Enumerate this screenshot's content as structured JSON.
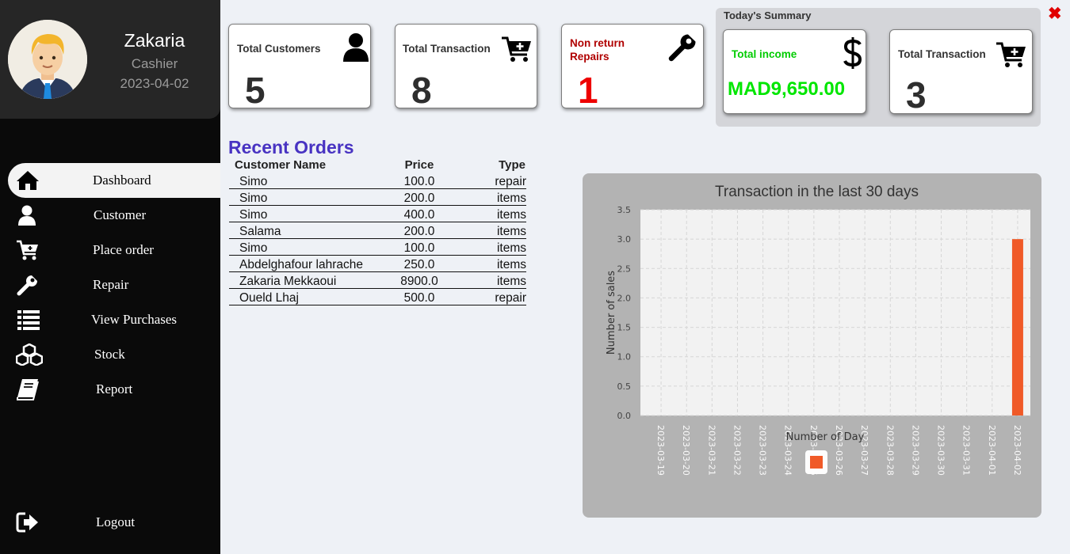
{
  "profile": {
    "name": "Zakaria",
    "role": "Cashier",
    "date": "2023-04-02"
  },
  "nav": [
    {
      "id": "dashboard",
      "label": "Dashboard",
      "icon": "home-icon",
      "active": true
    },
    {
      "id": "customer",
      "label": "Customer",
      "icon": "user-icon"
    },
    {
      "id": "place-order",
      "label": "Place order",
      "icon": "cart-plus-icon"
    },
    {
      "id": "repair",
      "label": "Repair",
      "icon": "wrench-icon"
    },
    {
      "id": "view-purchases",
      "label": "View Purchases",
      "icon": "list-icon"
    },
    {
      "id": "stock",
      "label": "Stock",
      "icon": "boxes-icon"
    },
    {
      "id": "report",
      "label": "Report",
      "icon": "book-icon"
    }
  ],
  "logout": {
    "label": "Logout",
    "icon": "logout-icon"
  },
  "cards": {
    "total_customers": {
      "title": "Total Customers",
      "value": "5",
      "icon": "user-icon"
    },
    "total_transaction": {
      "title": "Total Transaction",
      "value": "8",
      "icon": "cart-plus-icon"
    },
    "non_return_repairs": {
      "title": "Non return Repairs",
      "value": "1",
      "icon": "wrench-icon",
      "color": "#ee0000",
      "title_color": "#b00000"
    }
  },
  "summary": {
    "title": "Today's Summary",
    "income": {
      "title": "Total income",
      "value": "MAD9,650.00",
      "icon": "dollar-icon",
      "color": "#00e600"
    },
    "transaction": {
      "title": "Total Transaction",
      "value": "3",
      "icon": "cart-plus-icon"
    }
  },
  "recent_orders": {
    "title": "Recent Orders",
    "columns": [
      "Customer Name",
      "Price",
      "Type"
    ],
    "rows": [
      [
        "Simo",
        "100.0",
        "repair"
      ],
      [
        "Simo",
        "200.0",
        "items"
      ],
      [
        "Simo",
        "400.0",
        "items"
      ],
      [
        "Salama",
        "200.0",
        "items"
      ],
      [
        "Simo",
        "100.0",
        "items"
      ],
      [
        "Abdelghafour lahrache",
        "250.0",
        "items"
      ],
      [
        "Zakaria Mekkaoui",
        "8900.0",
        "items"
      ],
      [
        "Oueld Lhaj",
        "500.0",
        "repair"
      ]
    ]
  },
  "chart_data": {
    "type": "bar",
    "title": "Transaction in the last 30 days",
    "xlabel": "Number of Day",
    "ylabel": "Number of sales",
    "categories": [
      "2023-03-19",
      "2023-03-20",
      "2023-03-21",
      "2023-03-22",
      "2023-03-23",
      "2023-03-24",
      "2023-03-25",
      "2023-03-26",
      "2023-03-27",
      "2023-03-28",
      "2023-03-29",
      "2023-03-30",
      "2023-03-31",
      "2023-04-01",
      "2023-04-02"
    ],
    "values": [
      0,
      0,
      0,
      0,
      0,
      0,
      0,
      0,
      0,
      0,
      0,
      0,
      0,
      0,
      3
    ],
    "ylim": [
      0,
      3.5
    ],
    "yticks": [
      "0.0",
      "0.5",
      "1.0",
      "1.5",
      "2.0",
      "2.5",
      "3.0",
      "3.5"
    ],
    "grid": true,
    "legend": "bottom",
    "bar_color": "#f05a28"
  },
  "colors": {
    "sidebar": "#0a0a0a",
    "accent_title": "#4833c2",
    "close": "#e00000"
  }
}
